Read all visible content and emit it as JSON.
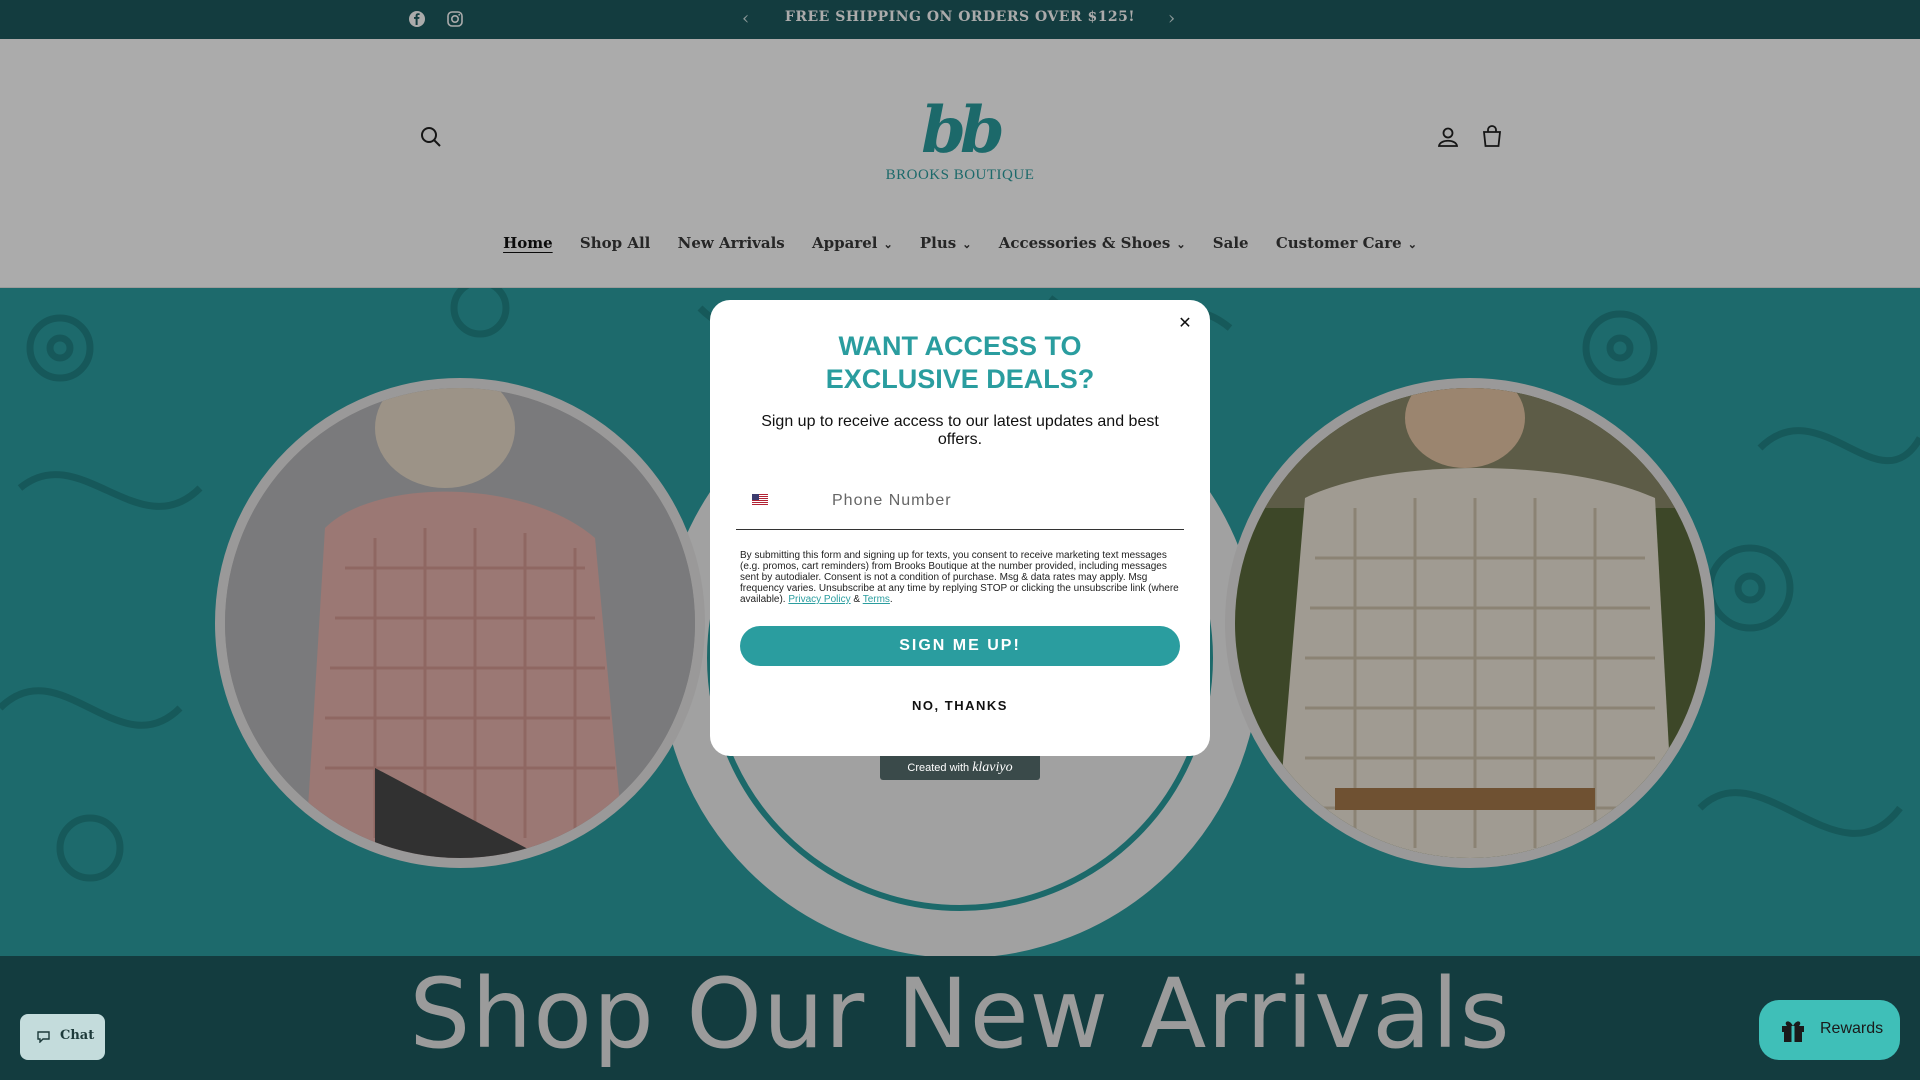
{
  "announcement": {
    "message": "FREE SHIPPING ON ORDERS OVER $125!",
    "prev_label": "‹",
    "next_label": "›",
    "social": [
      "facebook-icon",
      "instagram-icon"
    ]
  },
  "header": {
    "logo_mono": "bb",
    "logo_name": "BROOKS BOUTIQUE",
    "icons": [
      "search-icon",
      "account-icon",
      "cart-icon"
    ]
  },
  "nav": {
    "items": [
      {
        "label": "Home",
        "dropdown": false,
        "active": true
      },
      {
        "label": "Shop All",
        "dropdown": false
      },
      {
        "label": "New Arrivals",
        "dropdown": false
      },
      {
        "label": "Apparel",
        "dropdown": true
      },
      {
        "label": "Plus",
        "dropdown": true
      },
      {
        "label": "Accessories & Shoes",
        "dropdown": true
      },
      {
        "label": "Sale",
        "dropdown": false
      },
      {
        "label": "Customer Care",
        "dropdown": true
      }
    ],
    "caret": "⌄"
  },
  "banner": {
    "text": "Shop Our New Arrivals"
  },
  "modal": {
    "close": "✕",
    "headline_line1": "WANT ACCESS TO",
    "headline_line2": "EXCLUSIVE DEALS?",
    "subtext": "Sign up to receive access to our latest updates and best offers.",
    "phone_placeholder": "Phone Number",
    "legal_text": "By submitting this form and signing up for texts, you consent to receive marketing text messages (e.g. promos, cart reminders) from Brooks Boutique at the number provided, including messages sent by autodialer. Consent is not a condition of purchase. Msg & data rates may apply. Msg frequency varies. Unsubscribe at any time by replying STOP or clicking the unsubscribe link (where available).",
    "privacy_label": "Privacy Policy",
    "and": "&",
    "terms_label": "Terms",
    "period": ".",
    "signup_label": "SIGN ME UP!",
    "decline_label": "NO, THANKS"
  },
  "klaviyo": {
    "prefix": "Created with",
    "brand": "klaviyo"
  },
  "widgets": {
    "chat_label": "Chat",
    "rewards_label": "Rewards"
  },
  "colors": {
    "brand_teal": "#2a9d9f",
    "dark_teal": "#1d5a5e",
    "rewards": "#3fbfb8"
  }
}
